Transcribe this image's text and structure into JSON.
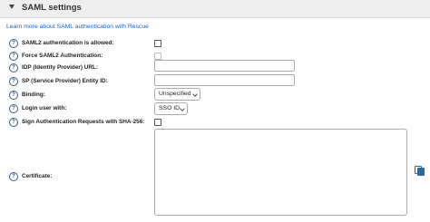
{
  "header": {
    "title": "SAML settings"
  },
  "learn_more_link": "Learn more about SAML authentication with Rescue",
  "help_glyph": "?",
  "fields": {
    "saml2_allowed": {
      "label": "SAML2 authentication is allowed:"
    },
    "force_saml2": {
      "label": "Force SAML2 Authentication:"
    },
    "idp_url": {
      "label": "IDP (Identity Provider) URL:",
      "value": ""
    },
    "sp_entity_id": {
      "label": "SP (Service Provider) Entity ID:",
      "value": ""
    },
    "binding": {
      "label": "Binding:",
      "value": "Unspecified"
    },
    "login_user_with": {
      "label": "Login user with:",
      "value": "SSO ID"
    },
    "sign_sha256": {
      "label": "Sign Authentication Requests with SHA-256:"
    },
    "certificate": {
      "label": "Certificate:",
      "value": ""
    }
  },
  "icons": {
    "help": "help-circle-icon",
    "copy": "copy-icon",
    "collapse": "caret-down-icon"
  },
  "colors": {
    "link": "#1a62c4",
    "header_bg": "#eeeeee",
    "icon": "#2d6aa3"
  }
}
